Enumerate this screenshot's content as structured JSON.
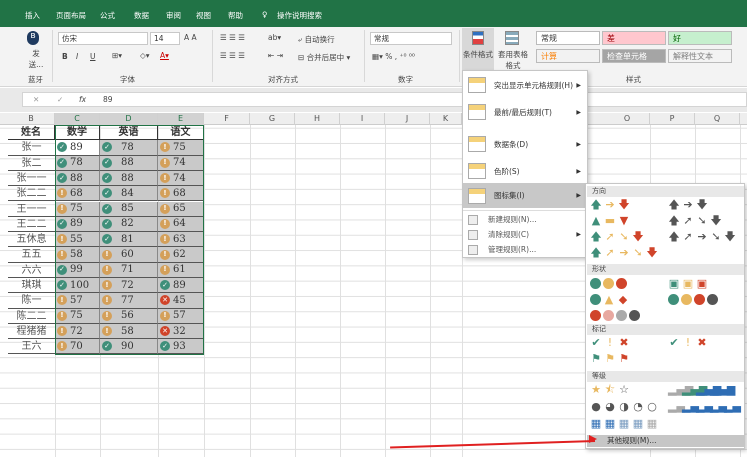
{
  "ribbon_tabs": [
    "插入",
    "页面布局",
    "公式",
    "数据",
    "审阅",
    "视图",
    "帮助",
    "操作说明搜索"
  ],
  "bluetooth": {
    "label": "发送...",
    "group": "蓝牙"
  },
  "font": {
    "name": "仿宋",
    "size": "14",
    "group": "字体",
    "bold": "B",
    "italic": "I",
    "underline": "U"
  },
  "alignment": {
    "wrap": "自动换行",
    "merge": "合并后居中",
    "group": "对齐方式"
  },
  "number": {
    "format": "常规",
    "percent": "%",
    "group": "数字"
  },
  "styles": {
    "conditional": "条件格式",
    "table": "套用表格格式",
    "group": "样式",
    "cells": [
      {
        "label": "常规",
        "bg": "#ffffff",
        "color": "#333"
      },
      {
        "label": "差",
        "bg": "#ffc7ce",
        "color": "#9c0006"
      },
      {
        "label": "好",
        "bg": "#c6efce",
        "color": "#006100"
      },
      {
        "label": "计算",
        "bg": "#f2f2f2",
        "color": "#fa7d00"
      },
      {
        "label": "检查单元格",
        "bg": "#a5a5a5",
        "color": "#ffffff"
      },
      {
        "label": "解释性文本",
        "bg": "#f3f3f3",
        "color": "#7f7f7f"
      }
    ]
  },
  "formula_bar": {
    "value": "89",
    "fx": "fx",
    "cancel": "✕",
    "enter": "✓"
  },
  "columns": [
    "B",
    "C",
    "D",
    "E",
    "F",
    "G",
    "H",
    "I",
    "J",
    "K",
    "O",
    "P",
    "Q"
  ],
  "table": {
    "headers": [
      "姓名",
      "数学",
      "英语",
      "语文"
    ],
    "rows": [
      [
        "张一",
        89,
        "check",
        78,
        "check",
        75,
        "warn"
      ],
      [
        "张二",
        78,
        "check",
        88,
        "check",
        74,
        "warn"
      ],
      [
        "张一一",
        88,
        "check",
        88,
        "check",
        74,
        "warn"
      ],
      [
        "张二二",
        68,
        "warn",
        84,
        "check",
        68,
        "warn"
      ],
      [
        "王一一",
        75,
        "warn",
        85,
        "check",
        65,
        "warn"
      ],
      [
        "王二二",
        89,
        "check",
        82,
        "check",
        64,
        "warn"
      ],
      [
        "五休息",
        55,
        "warn",
        81,
        "check",
        63,
        "warn"
      ],
      [
        "五五",
        58,
        "warn",
        60,
        "warn",
        62,
        "warn"
      ],
      [
        "六六",
        99,
        "check",
        71,
        "warn",
        61,
        "warn"
      ],
      [
        "琪琪",
        100,
        "check",
        72,
        "warn",
        89,
        "check"
      ],
      [
        "陈一",
        57,
        "warn",
        77,
        "warn",
        45,
        "cross"
      ],
      [
        "陈二二",
        75,
        "warn",
        56,
        "warn",
        57,
        "warn"
      ],
      [
        "程猪猪",
        72,
        "warn",
        58,
        "warn",
        32,
        "cross"
      ],
      [
        "王六",
        70,
        "warn",
        90,
        "check",
        93,
        "check"
      ]
    ]
  },
  "menu": {
    "items": [
      "突出显示单元格规则(H)",
      "最前/最后规则(T)",
      "数据条(D)",
      "色阶(S)",
      "图标集(I)"
    ],
    "small": [
      "新建规则(N)...",
      "清除规则(C)",
      "管理规则(R)..."
    ]
  },
  "submenu": {
    "sections": [
      "方向",
      "形状",
      "标记",
      "等级"
    ],
    "more": "其他规则(M)..."
  }
}
